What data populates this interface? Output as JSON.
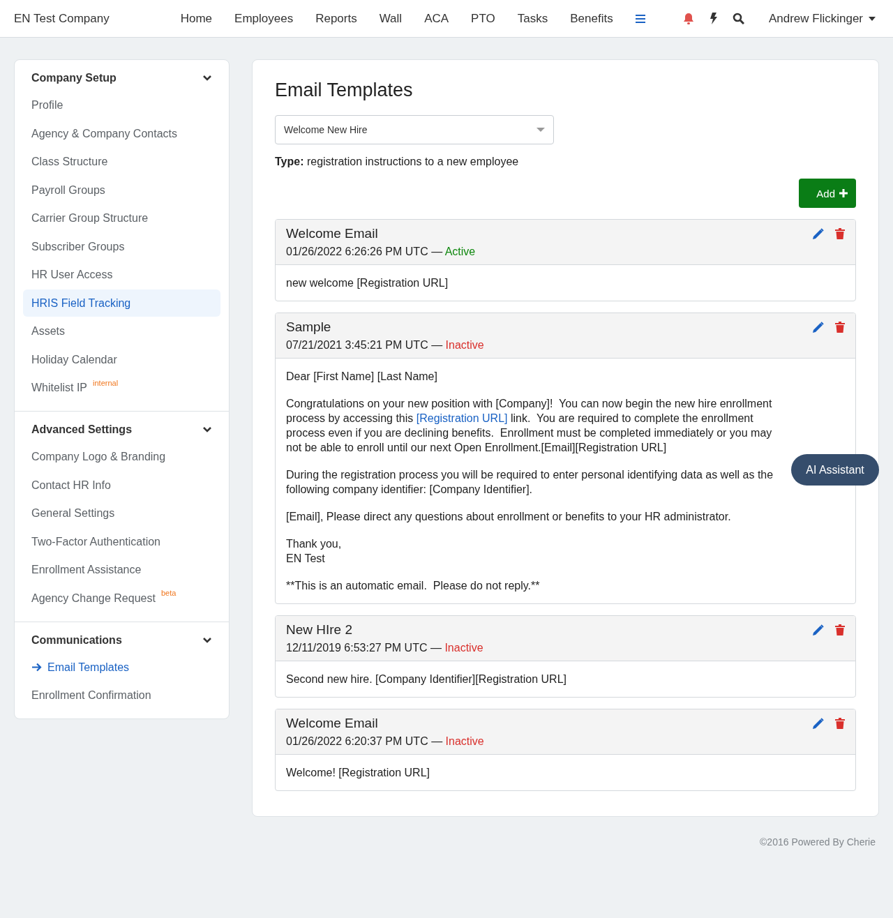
{
  "nav": {
    "company": "EN Test Company",
    "links": [
      "Home",
      "Employees",
      "Reports",
      "Wall",
      "ACA",
      "PTO",
      "Tasks",
      "Benefits"
    ],
    "user": "Andrew Flickinger"
  },
  "sidebar": [
    {
      "title": "Company Setup",
      "expanded": true,
      "items": [
        {
          "label": "Profile",
          "highlighted": false,
          "current": false
        },
        {
          "label": "Agency & Company Contacts",
          "highlighted": false,
          "current": false
        },
        {
          "label": "Class Structure",
          "highlighted": false,
          "current": false
        },
        {
          "label": "Payroll Groups",
          "highlighted": false,
          "current": false
        },
        {
          "label": "Carrier Group Structure",
          "highlighted": false,
          "current": false
        },
        {
          "label": "Subscriber Groups",
          "highlighted": false,
          "current": false
        },
        {
          "label": "HR User Access",
          "highlighted": false,
          "current": false
        },
        {
          "label": "HRIS Field Tracking",
          "highlighted": true,
          "current": false
        },
        {
          "label": "Assets",
          "highlighted": false,
          "current": false
        },
        {
          "label": "Holiday Calendar",
          "highlighted": false,
          "current": false
        },
        {
          "label": "Whitelist IP",
          "badge": "internal",
          "highlighted": false,
          "current": false
        }
      ]
    },
    {
      "title": "Advanced Settings",
      "expanded": true,
      "items": [
        {
          "label": "Company Logo & Branding",
          "highlighted": false,
          "current": false
        },
        {
          "label": "Contact HR Info",
          "highlighted": false,
          "current": false
        },
        {
          "label": "General Settings",
          "highlighted": false,
          "current": false
        },
        {
          "label": "Two-Factor Authentication",
          "highlighted": false,
          "current": false
        },
        {
          "label": "Enrollment Assistance",
          "highlighted": false,
          "current": false
        },
        {
          "label": "Agency Change Request",
          "badge": "beta",
          "highlighted": false,
          "current": false
        }
      ]
    },
    {
      "title": "Communications",
      "expanded": true,
      "items": [
        {
          "label": "Email Templates",
          "highlighted": false,
          "current": true
        },
        {
          "label": "Enrollment Confirmation",
          "highlighted": false,
          "current": false
        }
      ]
    }
  ],
  "main": {
    "title": "Email Templates",
    "template_select": {
      "value": "Welcome New Hire"
    },
    "type_label": "Type:",
    "type_text": "registration instructions to a new employee",
    "add_button": "Add",
    "templates": [
      {
        "title": "Welcome Email",
        "date": "01/26/2022 6:26:26 PM UTC —",
        "status": "Active",
        "active": true,
        "body": [
          [
            {
              "text": "new welcome [Registration URL]"
            }
          ]
        ]
      },
      {
        "title": "Sample",
        "date": "07/21/2021 3:45:21 PM UTC —",
        "status": "Inactive",
        "active": false,
        "body": [
          [
            {
              "text": "Dear [First Name] [Last Name]"
            }
          ],
          [
            {
              "text": "Congratulations on your new position with [Company]!  You can now begin the new hire enrollment process by accessing this "
            },
            {
              "text": "[Registration URL]",
              "kind": "link"
            },
            {
              "text": " link.  You are required to complete the enrollment process even if you are declining benefits.  Enrollment must be completed immediately or you may not be able to enroll until our next Open Enrollment.[Email][Registration URL]"
            }
          ],
          [
            {
              "text": "During the registration process you will be required to enter personal identifying data as well as the following company identifier: [Company Identifier]."
            }
          ],
          [
            {
              "text": "[Email], Please direct any questions about enrollment or benefits to your HR administrator."
            }
          ],
          [
            {
              "text": "Thank you,\nEN Test"
            }
          ],
          [
            {
              "text": "**This is an automatic email.  Please do not reply.**"
            }
          ]
        ]
      },
      {
        "title": "New HIre 2",
        "date": "12/11/2019 6:53:27 PM UTC —",
        "status": "Inactive",
        "active": false,
        "body": [
          [
            {
              "text": "Second new hire. [Company Identifier][Registration URL]"
            }
          ]
        ]
      },
      {
        "title": "Welcome Email",
        "date": "01/26/2022 6:20:37 PM UTC —",
        "status": "Inactive",
        "active": false,
        "body": [
          [
            {
              "text": "Welcome! [Registration URL]"
            }
          ]
        ]
      }
    ]
  },
  "assistant_button": "AI Assistant",
  "footer": "©2016 Powered By Cherie"
}
